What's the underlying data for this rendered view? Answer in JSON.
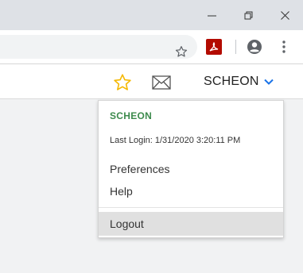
{
  "browser": {
    "window_controls": {
      "minimize_icon": "minimize-icon",
      "restore_icon": "restore-icon",
      "close_icon": "close-icon"
    },
    "toolbar_icons": [
      "star-icon",
      "pdf-extension-icon",
      "account-circle-icon",
      "more-vert-icon"
    ]
  },
  "header": {
    "icons": [
      "favorite-star-icon",
      "mail-icon"
    ],
    "user_label": "SCHEON",
    "colors": {
      "star": "#f5b800",
      "chevron": "#1a73e8"
    }
  },
  "user_menu": {
    "username": "SCHEON",
    "last_login": "Last Login: 1/31/2020 3:20:11 PM",
    "items": [
      {
        "label": "Preferences"
      },
      {
        "label": "Help"
      }
    ],
    "logout_label": "Logout",
    "colors": {
      "username": "#3c8a4c",
      "logout_highlight": "#e0e0e0"
    }
  }
}
